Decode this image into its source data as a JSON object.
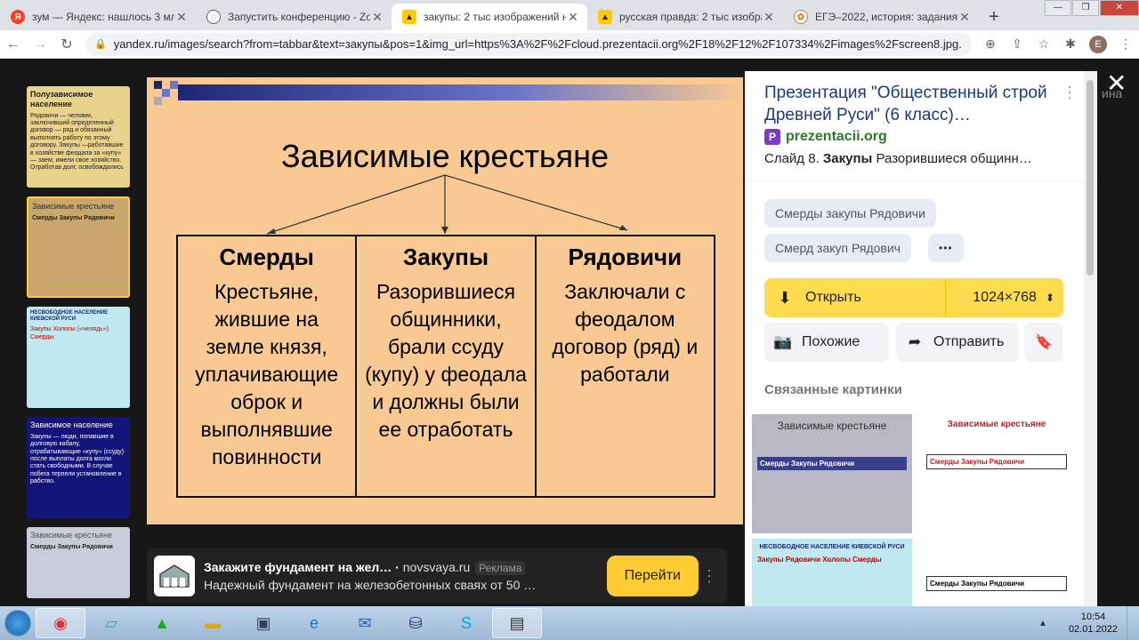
{
  "browser": {
    "tabs": [
      {
        "title": "зум — Яндекс: нашлось 3 млн р",
        "favicon": "yandex-icon",
        "active": false
      },
      {
        "title": "Запустить конференцию - Zoom",
        "favicon": "globe-icon",
        "active": false
      },
      {
        "title": "закупы: 2 тыс изображений на",
        "favicon": "yandex-images-icon",
        "active": true
      },
      {
        "title": "русская правда: 2 тыс изображ",
        "favicon": "yandex-images-icon",
        "active": false
      },
      {
        "title": "ЕГЭ–2022, история: задания, от",
        "favicon": "site-icon",
        "active": false
      }
    ],
    "new_tab": "+",
    "url": "yandex.ru/images/search?from=tabbar&text=закупы&pos=1&img_url=https%3A%2F%2Fcloud.prezentacii.org%2F18%2F12%2F107334%2Fimages%2Fscreen8.jpg...",
    "profile_initial": "E"
  },
  "slide": {
    "title": "Зависимые крестьяне",
    "columns": [
      {
        "heading": "Смерды",
        "text": "Крестьяне, жившие на земле князя, уплачивающие оброк и выполнявшие повинности"
      },
      {
        "heading": "Закупы",
        "text": "Разорившиеся общинники, брали ссуду (купу) у феодала и должны были ее отработать"
      },
      {
        "heading": "Рядовичи",
        "text": "Заключали с феодалом договор (ряд) и работали"
      }
    ]
  },
  "thumbnails": [
    {
      "title": "Полузависимое население",
      "text": "Рядовичи — человек, заключивший определенный договор — ряд и обязанный выполнять работу по этому договору. Закупы —работавшие в хозяйстве феодала за «купу» — заем, имели свое хозяйство. Отработав долг, освобождались",
      "bg": "#e9d28c"
    },
    {
      "title": "Зависимые крестьяне",
      "text": "Смерды  Закупы  Рядовичи",
      "bg": "#c9a66b"
    },
    {
      "title": "НЕСВОБОДНОЕ НАСЕЛЕНИЕ КИЕВСКОЙ РУСИ",
      "text": "Закупы  Холопы («челядь»)  Смерды",
      "bg": "#bfe9ef"
    },
    {
      "title": "Зависимое население",
      "text": "Закупы — люди, попавшие в долговую кабалу, отрабатывающие «купу» (ссуду) после выплаты долга могли стать свободными. В случае побега терпели установление в рабство.",
      "bg": "#13137a"
    },
    {
      "title": "Зависимые крестьяне",
      "text": "Смерды  Закупы  Рядовичи",
      "bg": "#c8cbd8"
    }
  ],
  "ad": {
    "title": "Закажите фундамент на жел…",
    "domain": "novsvaya.ru",
    "tag": "Реклама",
    "desc": "Надежный фундамент на железобетонных сваях от 50 …",
    "button": "Перейти"
  },
  "panel": {
    "title": "Презентация \"Общественный строй Древней Руси\" (6 класс)…",
    "source": "prezentacii.org",
    "desc_prefix": "Слайд 8. ",
    "desc_bold": "Закупы",
    "desc_rest": " Разорившиеся общинн…",
    "chips": [
      "Смерды закупы Рядовичи",
      "Смерд закуп Рядович",
      "•••"
    ],
    "open_label": "Открыть",
    "size": "1024×768",
    "similar_label": "Похожие",
    "share_label": "Отправить",
    "related_heading": "Связанные картинки",
    "related": [
      {
        "title": "Зависимые крестьяне",
        "cols": "Смерды  Закупы  Рядовичи"
      },
      {
        "title": "Зависимые крестьяне",
        "cols": "Смерды  Закупы  Рядовичи"
      },
      {
        "title": "НЕСВОБОДНОЕ НАСЕЛЕНИЕ КИЕВСКОЙ РУСИ",
        "cols": "Закупы  Рядовичи  Холопы  Смерды"
      },
      {
        "title": "",
        "cols": "Смерды  Закупы  Рядовичи"
      }
    ]
  },
  "background_text": "ина",
  "taskbar": {
    "time": "10:54",
    "date": "02.01.2022"
  }
}
